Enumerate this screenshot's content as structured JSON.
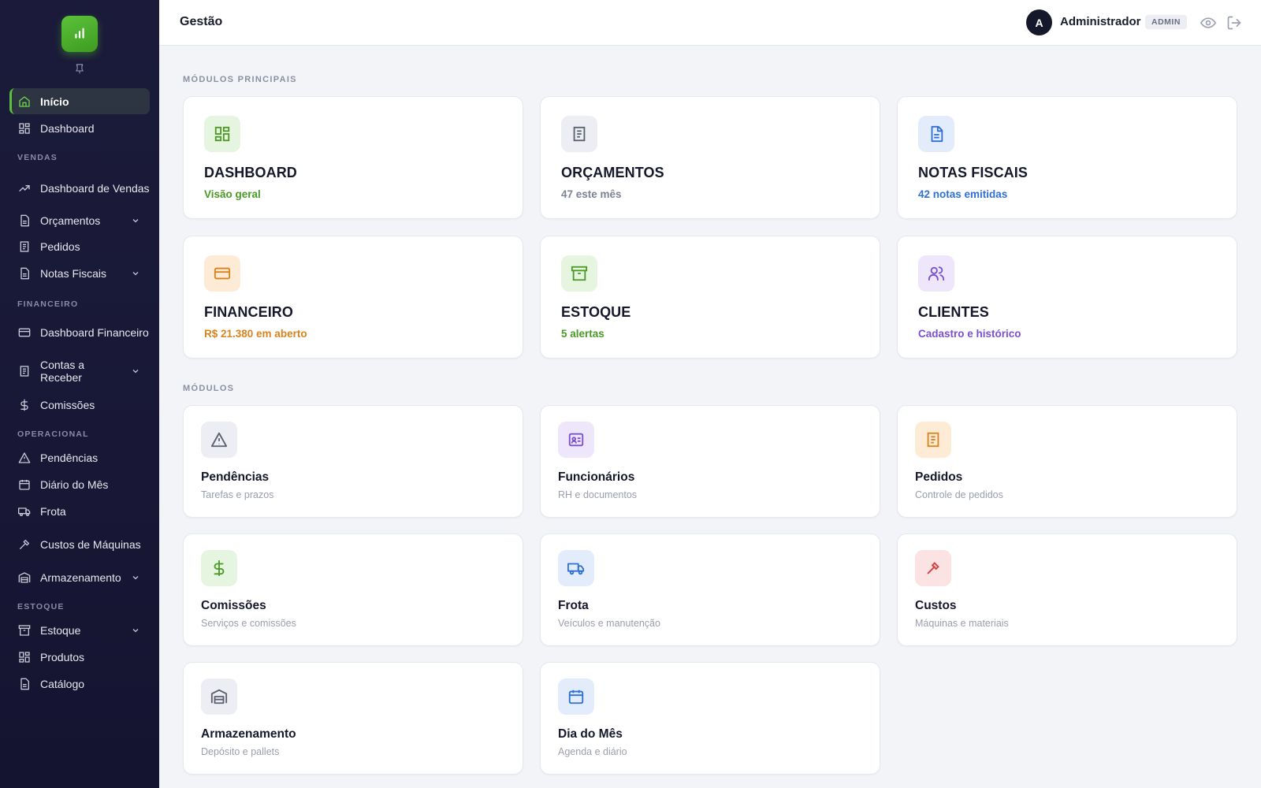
{
  "colors": {
    "accent": "#5cc13a",
    "sidebar_bg": "#1b1a3a",
    "green_text": "#4a9a25",
    "blue_text": "#2f6fd6",
    "orange_text": "#d9831c",
    "purple_text": "#7b4fd1",
    "gray_text": "#7d8294"
  },
  "sidebar": {
    "logo_icon": "bar-chart-icon",
    "items": [
      {
        "label": "Início",
        "icon": "home-icon",
        "active": true
      },
      {
        "label": "Dashboard",
        "icon": "grid-icon"
      },
      {
        "label": "Dashboard de Vendas",
        "icon": "trending-up-icon"
      },
      {
        "label": "Orçamentos",
        "icon": "file-icon",
        "expandable": true
      },
      {
        "label": "Pedidos",
        "icon": "receipt-icon"
      },
      {
        "label": "Notas Fiscais",
        "icon": "file-icon",
        "expandable": true
      },
      {
        "label": "Dashboard Financeiro",
        "icon": "credit-card-icon"
      },
      {
        "label": "Contas a Receber",
        "icon": "receipt-icon",
        "expandable": true
      },
      {
        "label": "Comissões",
        "icon": "dollar-icon"
      },
      {
        "label": "Pendências",
        "icon": "alert-triangle-icon"
      },
      {
        "label": "Diário do Mês",
        "icon": "calendar-icon"
      },
      {
        "label": "Frota",
        "icon": "truck-icon"
      },
      {
        "label": "Custos de Máquinas",
        "icon": "wrench-icon"
      },
      {
        "label": "Armazenamento",
        "icon": "warehouse-icon",
        "expandable": true
      },
      {
        "label": "Estoque",
        "icon": "archive-icon",
        "expandable": true
      },
      {
        "label": "Produtos",
        "icon": "grid-icon"
      },
      {
        "label": "Catálogo",
        "icon": "file-icon"
      }
    ],
    "sections": {
      "vendas": "VENDAS",
      "financeiro": "FINANCEIRO",
      "operacional": "OPERACIONAL",
      "estoque": "ESTOQUE"
    }
  },
  "header": {
    "title": "Gestão",
    "avatar_initial": "A",
    "user_name": "Administrador",
    "role_badge": "ADMIN",
    "icons": [
      "eye-icon",
      "logout-icon"
    ]
  },
  "main": {
    "section_main": "MÓDULOS PRINCIPAIS",
    "section_modules": "MÓDULOS",
    "main_cards": [
      {
        "title": "DASHBOARD",
        "subtitle": "Visão geral",
        "icon": "grid-icon"
      },
      {
        "title": "ORÇAMENTOS",
        "subtitle": "47 este mês",
        "icon": "receipt-icon"
      },
      {
        "title": "NOTAS FISCAIS",
        "subtitle": "42 notas emitidas",
        "icon": "file-text-icon"
      },
      {
        "title": "FINANCEIRO",
        "subtitle": "R$ 21.380 em aberto",
        "icon": "credit-card-icon"
      },
      {
        "title": "ESTOQUE",
        "subtitle": "5 alertas",
        "icon": "archive-icon"
      },
      {
        "title": "CLIENTES",
        "subtitle": "Cadastro e histórico",
        "icon": "users-icon"
      }
    ],
    "module_cards": [
      {
        "title": "Pendências",
        "subtitle": "Tarefas e prazos",
        "icon": "alert-triangle-icon"
      },
      {
        "title": "Funcionários",
        "subtitle": "RH e documentos",
        "icon": "id-card-icon"
      },
      {
        "title": "Pedidos",
        "subtitle": "Controle de pedidos",
        "icon": "receipt-icon"
      },
      {
        "title": "Comissões",
        "subtitle": "Serviços e comissões",
        "icon": "dollar-icon"
      },
      {
        "title": "Frota",
        "subtitle": "Veículos e manutenção",
        "icon": "truck-icon"
      },
      {
        "title": "Custos",
        "subtitle": "Máquinas e materiais",
        "icon": "wrench-icon"
      },
      {
        "title": "Armazenamento",
        "subtitle": "Depósito e pallets",
        "icon": "warehouse-icon"
      },
      {
        "title": "Dia do Mês",
        "subtitle": "Agenda e diário",
        "icon": "calendar-icon"
      }
    ]
  }
}
